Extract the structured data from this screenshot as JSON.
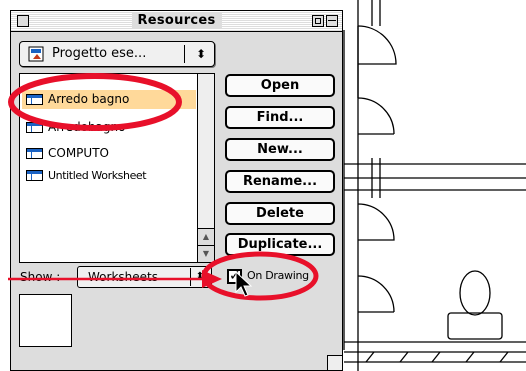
{
  "palette": {
    "title": "Resources",
    "project_popup": {
      "value": "Progetto ese...",
      "arrows": "⬍"
    },
    "resources": [
      {
        "label": "Arredo bagno",
        "selected": true,
        "icon": "worksheet-icon"
      },
      {
        "label": "Arredobagno",
        "selected": false,
        "icon": "worksheet-icon"
      },
      {
        "label": "COMPUTO",
        "selected": false,
        "icon": "worksheet-icon"
      },
      {
        "label": "Untitled Worksheet",
        "selected": false,
        "icon": "worksheet-icon"
      }
    ],
    "buttons": {
      "open": "Open",
      "find": "Find...",
      "new": "New...",
      "rename": "Rename...",
      "delete": "Delete",
      "duplicate": "Duplicate..."
    },
    "show": {
      "label": "Show :",
      "value": "Worksheets",
      "arrows": "⬍"
    },
    "on_drawing": {
      "label": "On Drawing",
      "checked": true,
      "mark": "✓"
    }
  },
  "annotations": {
    "highlight_color": "#e8102a"
  },
  "colors": {
    "selection": "#ffd99a",
    "icon_accent": "#1b63c4"
  }
}
